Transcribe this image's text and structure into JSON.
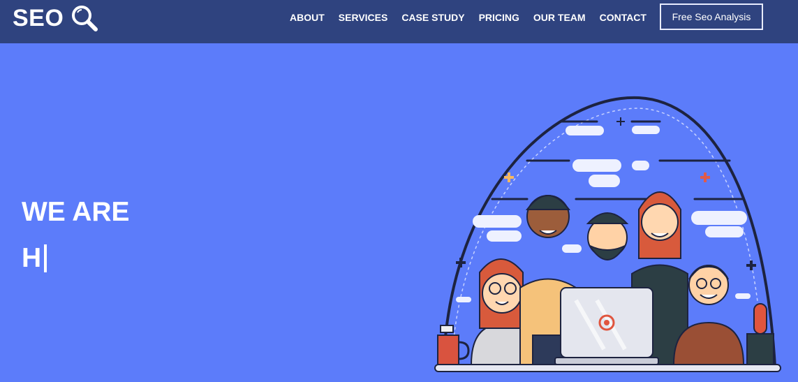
{
  "brand": {
    "name": "SEO",
    "icon": "magnifier-icon"
  },
  "nav": {
    "items": [
      "ABOUT",
      "SERVICES",
      "CASE STUDY",
      "PRICING",
      "OUR TEAM",
      "CONTACT"
    ],
    "cta": "Free Seo Analysis"
  },
  "hero": {
    "line1": "WE ARE",
    "line2": "H"
  },
  "colors": {
    "navbar": "#2f437f",
    "hero_bg": "#5c7cfa"
  }
}
